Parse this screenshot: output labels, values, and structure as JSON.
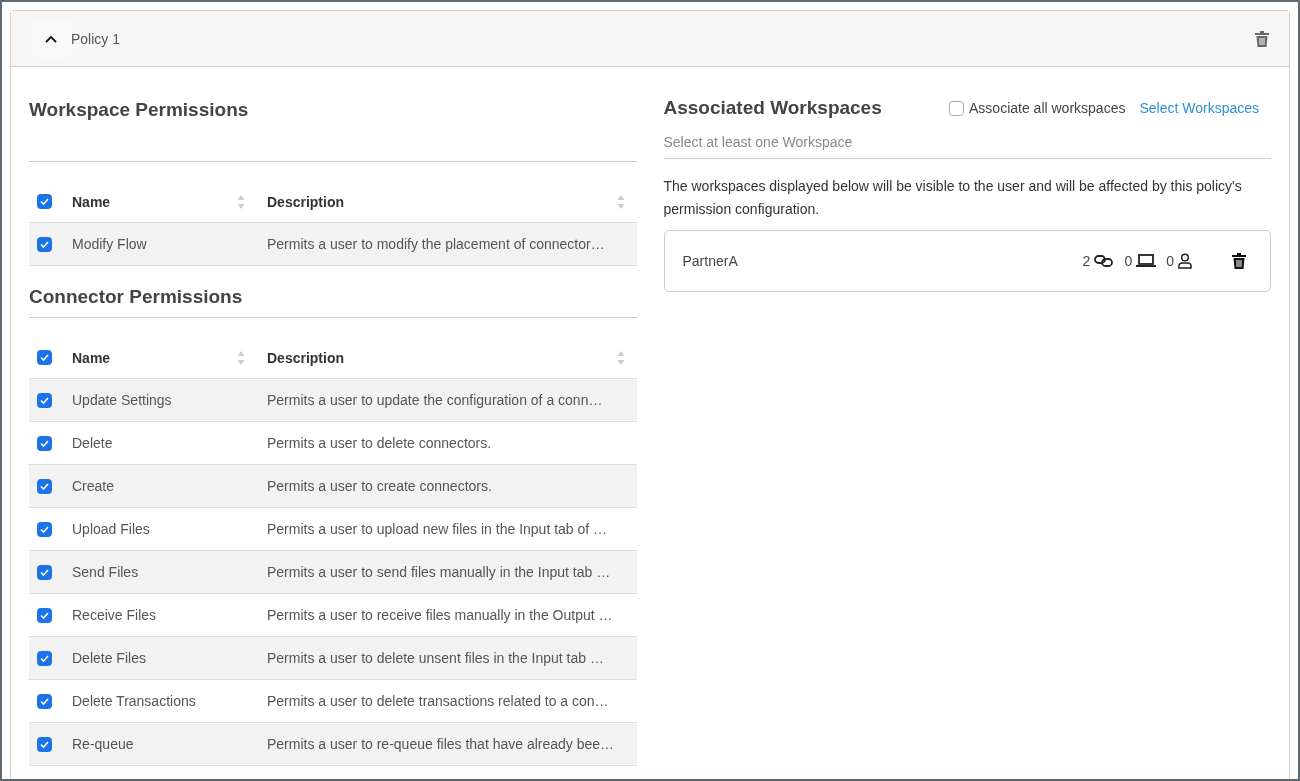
{
  "policy": {
    "title": "Policy 1",
    "expanded": true
  },
  "workspace_permissions": {
    "title": "Workspace Permissions",
    "columns": [
      "Name",
      "Description"
    ],
    "all_checked": true,
    "rows": [
      {
        "name": "Modify Flow",
        "description": "Permits a user to modify the placement of connector…",
        "checked": true
      }
    ]
  },
  "connector_permissions": {
    "title": "Connector Permissions",
    "columns": [
      "Name",
      "Description"
    ],
    "all_checked": true,
    "rows": [
      {
        "name": "Update Settings",
        "description": "Permits a user to update the configuration of a conn…",
        "checked": true
      },
      {
        "name": "Delete",
        "description": "Permits a user to delete connectors.",
        "checked": true
      },
      {
        "name": "Create",
        "description": "Permits a user to create connectors.",
        "checked": true
      },
      {
        "name": "Upload Files",
        "description": "Permits a user to upload new files in the Input tab of …",
        "checked": true
      },
      {
        "name": "Send Files",
        "description": "Permits a user to send files manually in the Input tab …",
        "checked": true
      },
      {
        "name": "Receive Files",
        "description": "Permits a user to receive files manually in the Output …",
        "checked": true
      },
      {
        "name": "Delete Files",
        "description": "Permits a user to delete unsent files in the Input tab …",
        "checked": true
      },
      {
        "name": "Delete Transactions",
        "description": "Permits a user to delete transactions related to a con…",
        "checked": true
      },
      {
        "name": "Re-queue",
        "description": "Permits a user to re-queue files that have already bee…",
        "checked": true
      }
    ]
  },
  "associated_workspaces": {
    "title": "Associated Workspaces",
    "associate_all": {
      "label": "Associate all workspaces",
      "checked": false
    },
    "select_link": "Select Workspaces",
    "hint": "Select at least one Workspace",
    "info": "The workspaces displayed below will be visible to the user and will be affected by this policy's permission configuration.",
    "workspaces": [
      {
        "name": "PartnerA",
        "connections": "2",
        "devices": "0",
        "users": "0"
      }
    ]
  }
}
